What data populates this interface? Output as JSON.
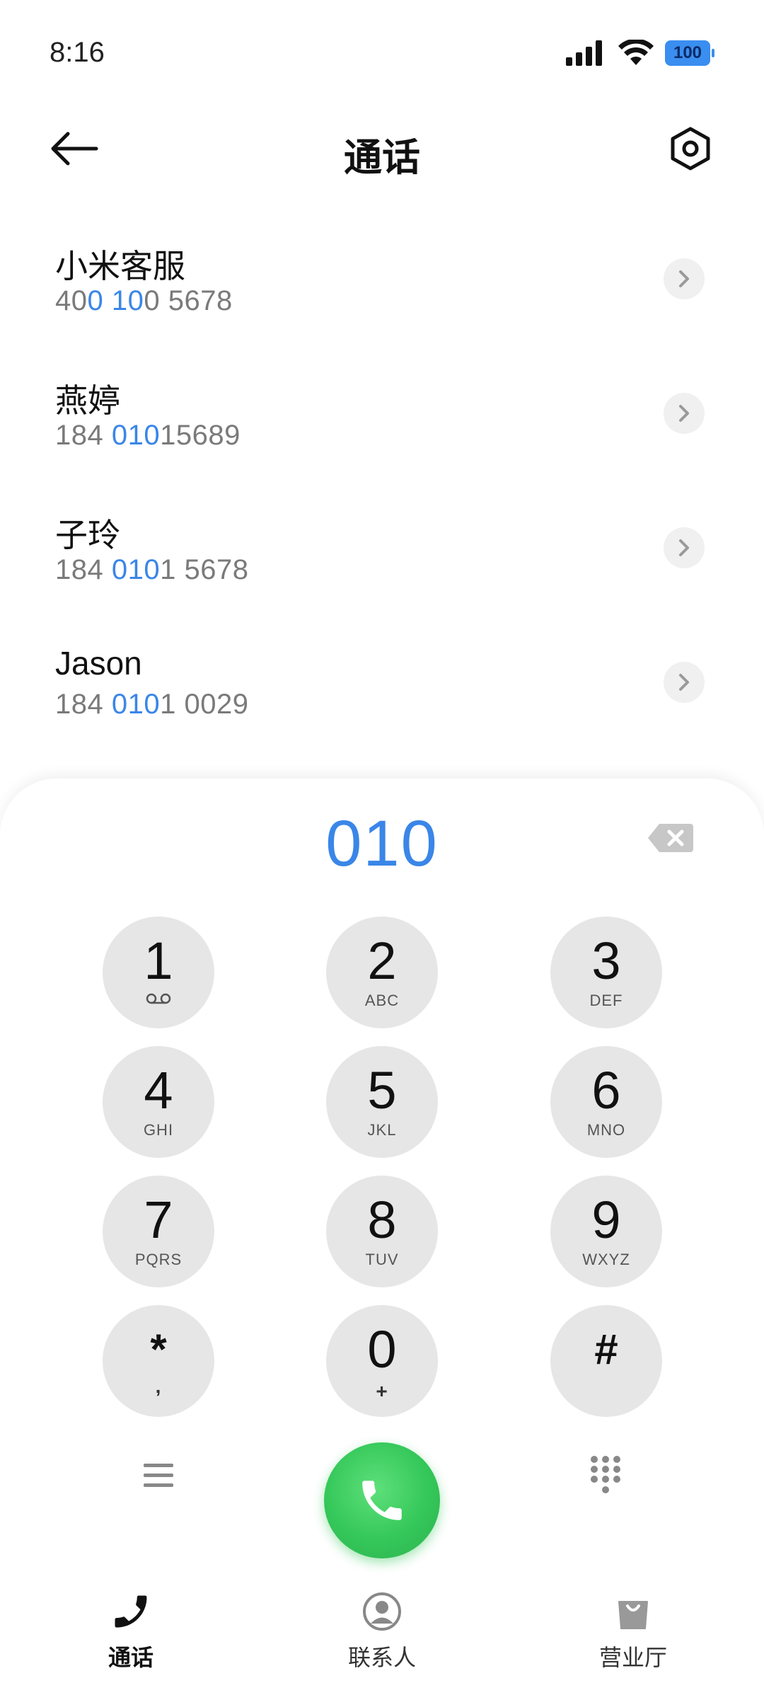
{
  "status": {
    "time": "8:16",
    "battery": "100"
  },
  "header": {
    "title": "通话"
  },
  "contacts": [
    {
      "name": "小米客服",
      "number_parts": [
        {
          "t": "40"
        },
        {
          "t": "0",
          "h": true
        },
        {
          "t": " "
        },
        {
          "t": "10",
          "h": true
        },
        {
          "t": "0 5678"
        }
      ]
    },
    {
      "name": "燕婷",
      "number_parts": [
        {
          "t": "184 "
        },
        {
          "t": "010",
          "h": true
        },
        {
          "t": "15689"
        }
      ]
    },
    {
      "name": "子玲",
      "number_parts": [
        {
          "t": "184 "
        },
        {
          "t": "010",
          "h": true
        },
        {
          "t": "1 5678"
        }
      ]
    },
    {
      "name": "Jason",
      "number_parts": [
        {
          "t": "184 "
        },
        {
          "t": "010",
          "h": true
        },
        {
          "t": "1 0029"
        }
      ]
    }
  ],
  "dialer": {
    "input": "010",
    "keys": [
      {
        "digit": "1",
        "letters": "ᴏᴏ"
      },
      {
        "digit": "2",
        "letters": "ABC"
      },
      {
        "digit": "3",
        "letters": "DEF"
      },
      {
        "digit": "4",
        "letters": "GHI"
      },
      {
        "digit": "5",
        "letters": "JKL"
      },
      {
        "digit": "6",
        "letters": "MNO"
      },
      {
        "digit": "7",
        "letters": "PQRS"
      },
      {
        "digit": "8",
        "letters": "TUV"
      },
      {
        "digit": "9",
        "letters": "WXYZ"
      },
      {
        "digit": "*",
        "letters": ","
      },
      {
        "digit": "0",
        "letters": "+"
      },
      {
        "digit": "#",
        "letters": ""
      }
    ]
  },
  "bottom_nav": [
    {
      "label": "通话",
      "icon": "phone-icon",
      "active": true
    },
    {
      "label": "联系人",
      "icon": "contact-icon",
      "active": false
    },
    {
      "label": "营业厅",
      "icon": "shopping-bag-icon",
      "active": false
    }
  ],
  "colors": {
    "accent": "#3a86e8",
    "call_green": "#34c759",
    "key_bg": "#e6e6e6"
  }
}
